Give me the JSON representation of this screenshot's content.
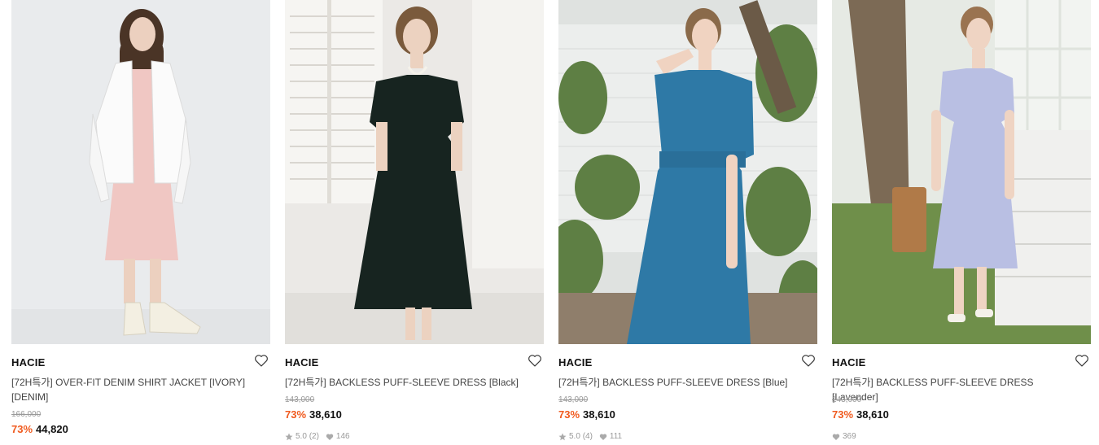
{
  "products": [
    {
      "brand": "HACIE",
      "title": "[72H특가] OVER-FIT DENIM SHIRT JACKET [IVORY] [DENIM]",
      "original_price": "166,000",
      "discount": "73%",
      "price": "44,820",
      "rating": "",
      "reviews": "",
      "likes": "",
      "image": "model-in-white-denim-jacket-and-pink-hoodie-dress"
    },
    {
      "brand": "HACIE",
      "title": "[72H특가] BACKLESS PUFF-SLEEVE DRESS [Black]",
      "original_price": "143,000",
      "discount": "73%",
      "price": "38,610",
      "rating": "5.0",
      "reviews": "(2)",
      "likes": "146",
      "image": "model-in-black-puff-sleeve-dress"
    },
    {
      "brand": "HACIE",
      "title": "[72H특가] BACKLESS PUFF-SLEEVE DRESS [Blue]",
      "original_price": "143,000",
      "discount": "73%",
      "price": "38,610",
      "rating": "5.0",
      "reviews": "(4)",
      "likes": "111",
      "image": "model-in-blue-puff-sleeve-dress"
    },
    {
      "brand": "HACIE",
      "title": "[72H특가] BACKLESS PUFF-SLEEVE DRESS [Lavender]",
      "original_price": "143,000",
      "discount": "73%",
      "price": "38,610",
      "rating": "",
      "reviews": "",
      "likes": "369",
      "image": "model-in-lavender-puff-sleeve-dress"
    }
  ],
  "colors": {
    "discount": "#f05a1e",
    "meta": "#999999"
  }
}
